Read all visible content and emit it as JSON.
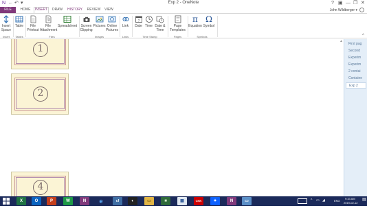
{
  "window": {
    "title": "Exp 2 - OneNote",
    "help": "?",
    "minimize": "—",
    "restore": "❐",
    "close": "✕",
    "quick_access": [
      "N",
      "←",
      "↶",
      "▾"
    ]
  },
  "tabs": [
    "FILE",
    "HOME",
    "INSERT",
    "DRAW",
    "HISTORY",
    "REVIEW",
    "VIEW"
  ],
  "user": {
    "name": "John Wildberger",
    "menu": "▾"
  },
  "ribbon": {
    "insert_space": "Insert Space",
    "table": "Table",
    "file_printout": "File Printout",
    "file_attachment": "File Attachment",
    "spreadsheet": "Spreadsheet",
    "screen_clipping": "Screen Clipping",
    "pictures": "Pictures",
    "online_pictures": "Online Pictures",
    "link": "Link",
    "date": "Date",
    "time": "Time",
    "date_time": "Date & Time",
    "page_templates": "Page Templates",
    "equation": "Equation",
    "symbol": "Symbol",
    "groups": {
      "insert": "Insert",
      "tables": "Tables",
      "files": "Files",
      "images": "Images",
      "links": "Links",
      "time_stamp": "Time Stamp",
      "pages": "Pages",
      "symbols": "Symbols"
    },
    "collapse": "^"
  },
  "cards": [
    {
      "label": "1"
    },
    {
      "label": "2"
    },
    {
      "label": "4"
    }
  ],
  "pages_pane": {
    "items": [
      "First pag",
      "Second",
      "Experim",
      "Experim",
      "2 contai",
      "Containe",
      "Exp 2"
    ],
    "selected_index": 6
  },
  "taskbar": {
    "apps": [
      "X",
      "O",
      "P",
      "W",
      "N",
      "e",
      "cf",
      "◐",
      "▭",
      "■",
      "▦",
      "CNN",
      "✦",
      "N",
      "▭"
    ],
    "language": "ENG",
    "time": "9:33 AM",
    "date": "2019-02-12"
  }
}
